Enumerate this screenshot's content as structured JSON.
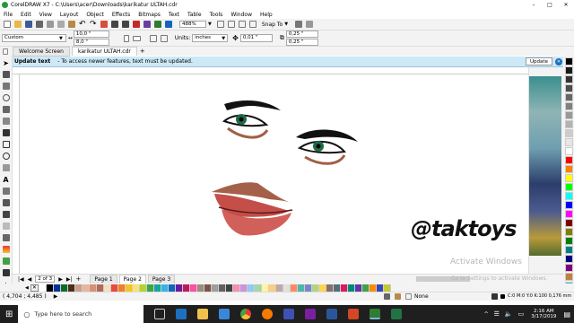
{
  "titlebar": {
    "title": "CorelDRAW X7 - C:\\Users\\acer\\Downloads\\karikatur ULTAH.cdr",
    "window_buttons": [
      "–",
      "□",
      "✕"
    ]
  },
  "menu": [
    "File",
    "Edit",
    "View",
    "Layout",
    "Object",
    "Effects",
    "Bitmaps",
    "Text",
    "Table",
    "Tools",
    "Window",
    "Help"
  ],
  "toolbar": {
    "zoom": "488%",
    "snap": "Snap To"
  },
  "propbar": {
    "preset": "Custom",
    "width": "10,0 \"",
    "height": "8,0 \"",
    "units_label": "Units:",
    "units": "inches",
    "nudge": "0,01 \"",
    "dup_x": "0,25 \"",
    "dup_y": "0,25 \""
  },
  "tabs": [
    "Welcome Screen",
    "karikatur ULTAH.cdr"
  ],
  "notify": {
    "title": "Update text",
    "message": "To access newer features, text must be updated.",
    "button": "Update"
  },
  "watermark": "@taktoys",
  "activation": {
    "line1": "Activate Windows",
    "line2": "Go to Settings to activate Windows."
  },
  "pagenav": {
    "count": "2 of 3",
    "pages": [
      "Page 1",
      "Page 2",
      "Page 3"
    ]
  },
  "status": {
    "coords": "( 4,704 ; 4,485 )",
    "fill": "None",
    "cmyk": "C:0 M:0 Y:0 K:100  0,176 mm"
  },
  "taskbar": {
    "search": "Type here to search",
    "time": "2:16 AM",
    "date": "3/17/2019"
  },
  "palette": [
    "#ffffff",
    "#000000",
    "#003399",
    "#0d6b2a",
    "#4a2f1f",
    "#c8a08a",
    "#e9b49a",
    "#d7907a",
    "#b46a55",
    "#efe0c8",
    "#e84b3c",
    "#f07f2a",
    "#f3c623",
    "#fbe36b",
    "#b4d333",
    "#3aa54b",
    "#1aa39a",
    "#33b5e5",
    "#1565c0",
    "#6a1b9a",
    "#c2185b",
    "#ff4fa3",
    "#a1887f",
    "#795548",
    "#9e9e9e",
    "#616161",
    "#424242",
    "#f48fb1",
    "#ce93d8",
    "#90caf9",
    "#a5d6a7",
    "#fff59d",
    "#ffcc80",
    "#bcaaa4",
    "#e0e0e0",
    "#ff8a65",
    "#4db6ac",
    "#7986cb",
    "#aed581",
    "#ffd54f",
    "#8d6e63",
    "#546e7a",
    "#d81b60",
    "#00897b",
    "#5e35b1",
    "#43a047",
    "#fb8c00",
    "#3949ab",
    "#c0ca33"
  ],
  "side_palette": [
    "#000000",
    "#1a1a1a",
    "#333333",
    "#4d4d4d",
    "#666666",
    "#808080",
    "#999999",
    "#b3b3b3",
    "#cccccc",
    "#e6e6e6",
    "#ffffff",
    "#ff0000",
    "#ff8000",
    "#ffff00",
    "#00ff00",
    "#00ffff",
    "#0000ff",
    "#ff00ff",
    "#800000",
    "#808000",
    "#008000",
    "#008080",
    "#000080",
    "#800080",
    "#c08040",
    "#40c0c0"
  ],
  "colors": {
    "title_bg": "#f0f0f0",
    "notify_bg": "#cde8f6",
    "accent": "#1a6fc0"
  }
}
